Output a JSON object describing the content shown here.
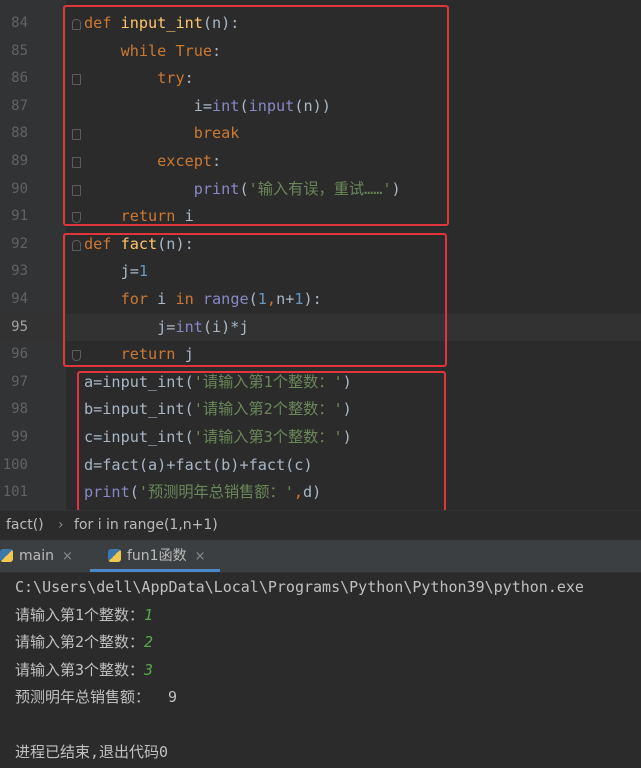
{
  "editor": {
    "lines": [
      {
        "num": "84",
        "tokens": [
          [
            "kw",
            "def "
          ],
          [
            "fn",
            "input_int"
          ],
          [
            "plain",
            "(n):"
          ]
        ]
      },
      {
        "num": "85",
        "tokens": [
          [
            "plain",
            "    "
          ],
          [
            "kw",
            "while True"
          ],
          [
            "plain",
            ":"
          ]
        ]
      },
      {
        "num": "86",
        "tokens": [
          [
            "plain",
            "        "
          ],
          [
            "kw",
            "try"
          ],
          [
            "plain",
            ":"
          ]
        ]
      },
      {
        "num": "87",
        "tokens": [
          [
            "plain",
            "            i="
          ],
          [
            "bi",
            "int"
          ],
          [
            "plain",
            "("
          ],
          [
            "bi",
            "input"
          ],
          [
            "plain",
            "(n))"
          ]
        ]
      },
      {
        "num": "88",
        "tokens": [
          [
            "plain",
            "            "
          ],
          [
            "kw",
            "break"
          ]
        ]
      },
      {
        "num": "89",
        "tokens": [
          [
            "plain",
            "        "
          ],
          [
            "kw",
            "except"
          ],
          [
            "plain",
            ":"
          ]
        ]
      },
      {
        "num": "90",
        "tokens": [
          [
            "plain",
            "            "
          ],
          [
            "bi",
            "print"
          ],
          [
            "plain",
            "("
          ],
          [
            "str",
            "'输入有误，重试……'"
          ],
          [
            "plain",
            ")"
          ]
        ]
      },
      {
        "num": "91",
        "tokens": [
          [
            "plain",
            "    "
          ],
          [
            "kw",
            "return "
          ],
          [
            "plain",
            "i"
          ]
        ]
      },
      {
        "num": "92",
        "tokens": [
          [
            "kw",
            "def "
          ],
          [
            "fn",
            "fact"
          ],
          [
            "plain",
            "(n):"
          ]
        ]
      },
      {
        "num": "93",
        "tokens": [
          [
            "plain",
            "    j="
          ],
          [
            "num",
            "1"
          ]
        ]
      },
      {
        "num": "94",
        "tokens": [
          [
            "plain",
            "    "
          ],
          [
            "kw",
            "for "
          ],
          [
            "plain",
            "i "
          ],
          [
            "kw",
            "in "
          ],
          [
            "bi",
            "range"
          ],
          [
            "plain",
            "("
          ],
          [
            "num",
            "1"
          ],
          [
            "kw",
            ","
          ],
          [
            "plain",
            "n+"
          ],
          [
            "num",
            "1"
          ],
          [
            "plain",
            "):"
          ]
        ]
      },
      {
        "num": "95",
        "tokens": [
          [
            "plain",
            "        j="
          ],
          [
            "bi",
            "int"
          ],
          [
            "plain",
            "(i)*j"
          ]
        ]
      },
      {
        "num": "96",
        "tokens": [
          [
            "plain",
            "    "
          ],
          [
            "kw",
            "return "
          ],
          [
            "plain",
            "j"
          ]
        ]
      },
      {
        "num": "97",
        "tokens": [
          [
            "plain",
            "a=input_int("
          ],
          [
            "str",
            "'请输入第1个整数：'"
          ],
          [
            "plain",
            ")"
          ]
        ]
      },
      {
        "num": "98",
        "tokens": [
          [
            "plain",
            "b=input_int("
          ],
          [
            "str",
            "'请输入第2个整数：'"
          ],
          [
            "plain",
            ")"
          ]
        ]
      },
      {
        "num": "99",
        "tokens": [
          [
            "plain",
            "c=input_int("
          ],
          [
            "str",
            "'请输入第3个整数：'"
          ],
          [
            "plain",
            ")"
          ]
        ]
      },
      {
        "num": "100",
        "tokens": [
          [
            "plain",
            "d=fact(a)+fact(b)+fact(c)"
          ]
        ]
      },
      {
        "num": "101",
        "tokens": [
          [
            "bi",
            "print"
          ],
          [
            "plain",
            "("
          ],
          [
            "str",
            "'预测明年总销售额：'"
          ],
          [
            "kw",
            ","
          ],
          [
            "plain",
            "d)"
          ]
        ]
      }
    ],
    "current_line": "95"
  },
  "breadcrumb": {
    "func": "fact()",
    "sep": "›",
    "loop": "for i in range(1,n+1)"
  },
  "run_tabs": [
    {
      "label": "main",
      "close": "×"
    },
    {
      "label": "fun1函数",
      "close": "×"
    }
  ],
  "console": {
    "path": "C:\\Users\\dell\\AppData\\Local\\Programs\\Python\\Python39\\python.exe",
    "prompt1": "请输入第1个整数：",
    "input1": "1",
    "prompt2": "请输入第2个整数：",
    "input2": "2",
    "prompt3": "请输入第3个整数：",
    "input3": "3",
    "result": "预测明年总销售额：  9",
    "exit": "进程已结束,退出代码0"
  },
  "colors": {
    "annotation_box": "#e0353a",
    "keyword": "#cc7832",
    "function": "#ffc66d",
    "string": "#6a8759",
    "number": "#6897bb",
    "builtin": "#8888c6",
    "console_input": "#56a848"
  }
}
